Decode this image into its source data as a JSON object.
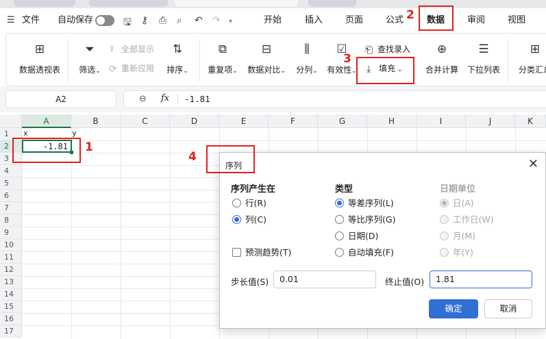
{
  "menubar": {
    "file": "文件",
    "autosave": "自动保存",
    "tabs": [
      "开始",
      "插入",
      "页面",
      "公式",
      "数据",
      "审阅",
      "视图"
    ],
    "active_tab": "数据"
  },
  "ribbon": {
    "pivot": "数据透视表",
    "filter": "筛选",
    "show_all": "全部显示",
    "reapply": "重新应用",
    "sort": "排序",
    "duplicates": "重复项",
    "compare": "数据对比",
    "split": "分列",
    "validity": "有效性",
    "lookup_entry": "查找录入",
    "fill": "填充",
    "consolidate": "合并计算",
    "dropdown": "下拉列表",
    "subtotal": "分类汇总"
  },
  "formula_bar": {
    "cell_ref": "A2",
    "fx": "fx",
    "formula": "-1.81"
  },
  "sheet": {
    "columns": [
      "A",
      "B",
      "C",
      "D",
      "E",
      "F",
      "G",
      "H",
      "I",
      "J",
      "K"
    ],
    "rows": [
      "1",
      "2",
      "3",
      "4",
      "5",
      "6",
      "7",
      "8",
      "9",
      "10",
      "11",
      "12",
      "13",
      "14",
      "15",
      "16",
      "17"
    ],
    "cells": {
      "A1": "x",
      "B1": "y",
      "A2": "-1.81"
    }
  },
  "annotations": [
    "1",
    "2",
    "3",
    "4"
  ],
  "annotation_color": "#e0201b",
  "accent_color": "#2f6fd6",
  "dialog": {
    "title": "序列",
    "series_in_heading": "序列产生在",
    "row_option": "行(R)",
    "col_option": "列(C)",
    "type_heading": "类型",
    "type_linear": "等差序列(L)",
    "type_growth": "等比序列(G)",
    "type_date": "日期(D)",
    "type_autofill": "自动填充(F)",
    "date_unit_heading": "日期单位",
    "unit_day": "日(A)",
    "unit_weekday": "工作日(W)",
    "unit_month": "月(M)",
    "unit_year": "年(Y)",
    "trend": "预测趋势(T)",
    "step_label": "步长值(S)",
    "step_value": "0.01",
    "stop_label": "终止值(O)",
    "stop_value": "1.81",
    "ok": "确定",
    "cancel": "取消"
  }
}
